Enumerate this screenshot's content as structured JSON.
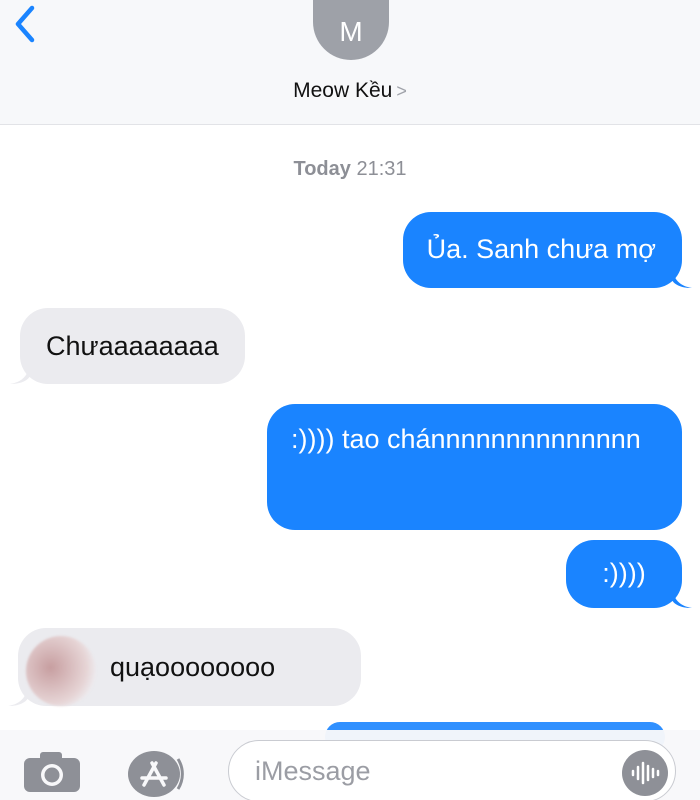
{
  "header": {
    "avatar_initial": "M",
    "contact_name": "Meow Kều",
    "chevron": ">"
  },
  "timestamp": {
    "day": "Today",
    "time": "21:31"
  },
  "messages": [
    {
      "direction": "sent",
      "text": "Ủa. Sanh chưa mợ"
    },
    {
      "direction": "received",
      "text": "Chưaaaaaaaa"
    },
    {
      "direction": "sent",
      "text": ":)))) tao chánnnnnnnnnnnnnn"
    },
    {
      "direction": "sent",
      "text": ":))))"
    },
    {
      "direction": "received",
      "text": "quạoooooooo"
    }
  ],
  "input_bar": {
    "placeholder": "iMessage"
  },
  "colors": {
    "sent_bubble": "#1a84ff",
    "received_bubble": "#ebebef",
    "accent": "#1a84ff"
  },
  "icons": [
    "back-chevron-icon",
    "camera-icon",
    "app-store-icon",
    "audio-waveform-icon"
  ]
}
